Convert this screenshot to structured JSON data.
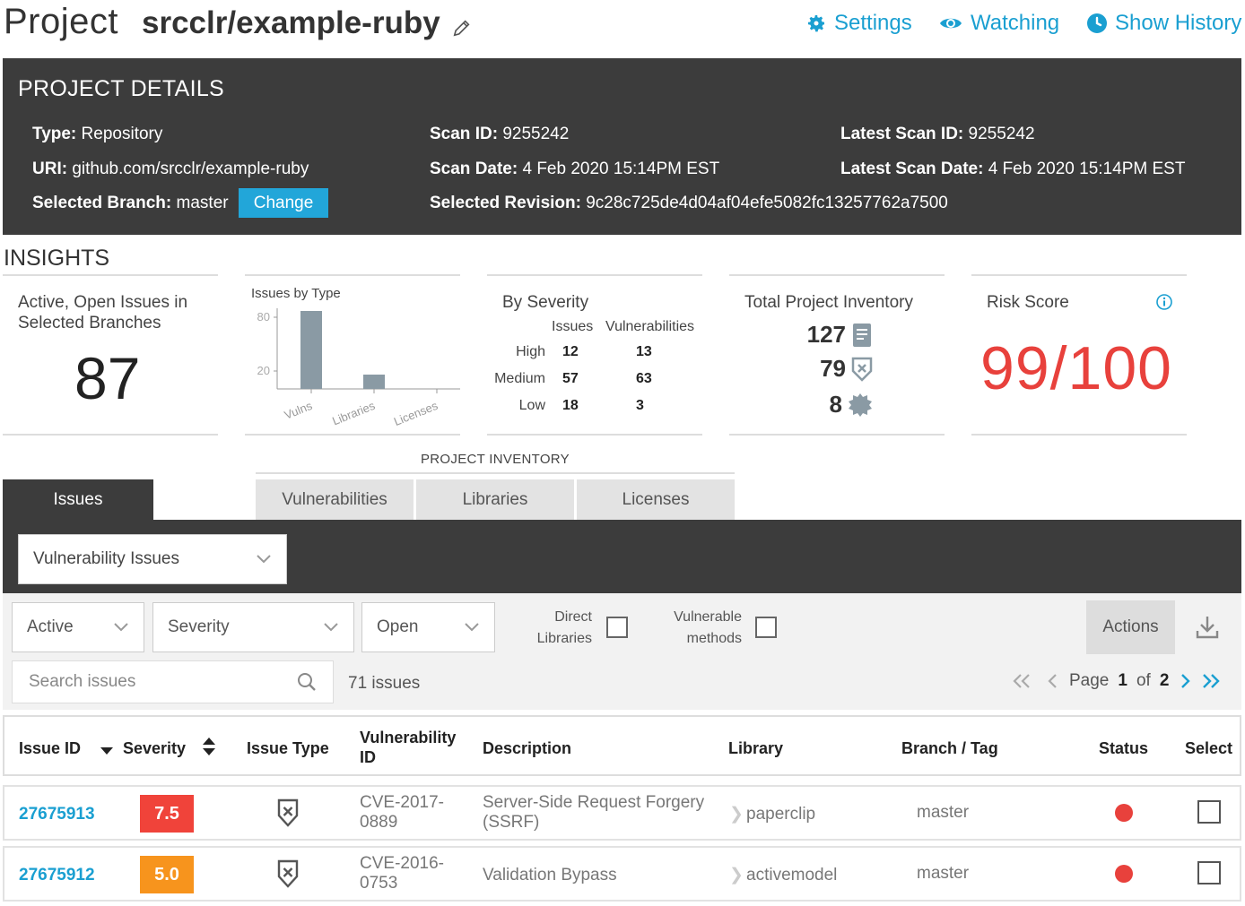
{
  "header": {
    "project_label": "Project",
    "project_name": "srcclr/example-ruby",
    "links": {
      "settings": "Settings",
      "watching": "Watching",
      "history": "Show History"
    }
  },
  "details": {
    "title": "PROJECT DETAILS",
    "type_label": "Type:",
    "type_value": "Repository",
    "uri_label": "URI:",
    "uri_value": "github.com/srcclr/example-ruby",
    "branch_label": "Selected Branch:",
    "branch_value": "master",
    "change_label": "Change",
    "scan_id_label": "Scan ID:",
    "scan_id_value": "9255242",
    "scan_date_label": "Scan Date:",
    "scan_date_value": "4 Feb 2020 15:14PM EST",
    "revision_label": "Selected Revision:",
    "revision_value": "9c28c725de4d04af04efe5082fc13257762a7500",
    "latest_scan_id_label": "Latest Scan ID:",
    "latest_scan_id_value": "9255242",
    "latest_scan_date_label": "Latest Scan Date:",
    "latest_scan_date_value": "4 Feb 2020 15:14PM EST"
  },
  "insights": {
    "title": "INSIGHTS",
    "open_issues": {
      "title_line1": "Active, Open Issues in",
      "title_line2": "Selected Branches",
      "count": "87"
    },
    "by_severity": {
      "title": "By Severity",
      "col_issues": "Issues",
      "col_vulns": "Vulnerabilities",
      "rows": [
        {
          "label": "High",
          "issues": "12",
          "vulns": "13"
        },
        {
          "label": "Medium",
          "issues": "57",
          "vulns": "63"
        },
        {
          "label": "Low",
          "issues": "18",
          "vulns": "3"
        }
      ]
    },
    "inventory": {
      "title": "Total Project Inventory",
      "libraries": "127",
      "vulnerabilities": "79",
      "licenses": "8"
    },
    "risk": {
      "title": "Risk Score",
      "value": "99/100"
    }
  },
  "chart_data": {
    "type": "bar",
    "title": "Issues by Type",
    "categories": [
      "Vulns",
      "Libraries",
      "Licenses"
    ],
    "values": [
      87,
      16,
      0
    ],
    "yticks": [
      "80",
      "20"
    ],
    "ylim": [
      0,
      100
    ]
  },
  "tabs": {
    "inventory_label": "PROJECT INVENTORY",
    "issues": "Issues",
    "vulnerabilities": "Vulnerabilities",
    "libraries": "Libraries",
    "licenses": "Licenses"
  },
  "filters": {
    "issue_kind": "Vulnerability Issues",
    "active": "Active",
    "severity": "Severity",
    "open": "Open",
    "direct_l1": "Direct",
    "direct_l2": "Libraries",
    "vmethods_l1": "Vulnerable",
    "vmethods_l2": "methods",
    "actions": "Actions",
    "search_placeholder": "Search issues",
    "issue_count": "71 issues",
    "page_word": "Page",
    "page_current": "1",
    "page_of": "of",
    "page_total": "2"
  },
  "table": {
    "headers": {
      "issue_id": "Issue ID",
      "severity": "Severity",
      "issue_type": "Issue Type",
      "vuln_id_l1": "Vulnerability",
      "vuln_id_l2": "ID",
      "description": "Description",
      "library": "Library",
      "branch": "Branch / Tag",
      "status": "Status",
      "select": "Select"
    },
    "rows": [
      {
        "id": "27675913",
        "severity": "7.5",
        "severity_color": "#f0433a",
        "vuln_l1": "CVE-2017-",
        "vuln_l2": "0889",
        "desc_l1": "Server-Side Request Forgery",
        "desc_l2": "(SSRF)",
        "library": "paperclip",
        "branch": "master",
        "status_color": "#e8413c"
      },
      {
        "id": "27675912",
        "severity": "5.0",
        "severity_color": "#f7941d",
        "vuln_l1": "CVE-2016-",
        "vuln_l2": "0753",
        "desc_l1": "Validation Bypass",
        "desc_l2": "",
        "library": "activemodel",
        "branch": "master",
        "status_color": "#e8413c"
      }
    ]
  },
  "colors": {
    "accent": "#1a9fd1",
    "dark_panel": "#3c3c3c",
    "risk": "#e8413c"
  }
}
